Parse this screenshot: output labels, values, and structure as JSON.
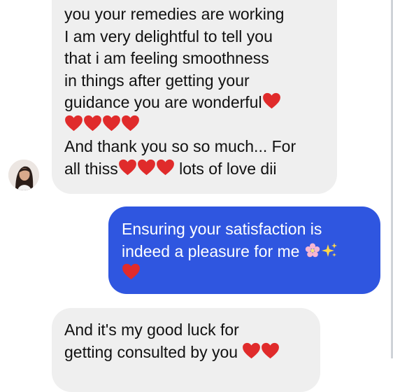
{
  "messages": [
    {
      "sender": "them",
      "lines": [
        "you your remedies are working",
        "I am very delightful to tell you",
        "that i am feeling smoothness",
        "in things after getting your",
        "guidance you are wonderful",
        "",
        "And thank you so so much... For",
        "all thiss",
        " lots of love dii"
      ]
    },
    {
      "sender": "me",
      "lines": [
        "Ensuring your satisfaction is",
        "indeed a pleasure for me"
      ]
    },
    {
      "sender": "them",
      "lines": [
        "And it's my  good luck for",
        "getting consulted by you"
      ]
    }
  ],
  "icons": {
    "heart": "red-heart-icon",
    "blossom": "cherry-blossom-icon",
    "sparkles": "sparkles-icon"
  },
  "colors": {
    "sent_bubble": "#2f56e0",
    "received_bubble": "#efefef",
    "heart": "#e02b2b"
  }
}
